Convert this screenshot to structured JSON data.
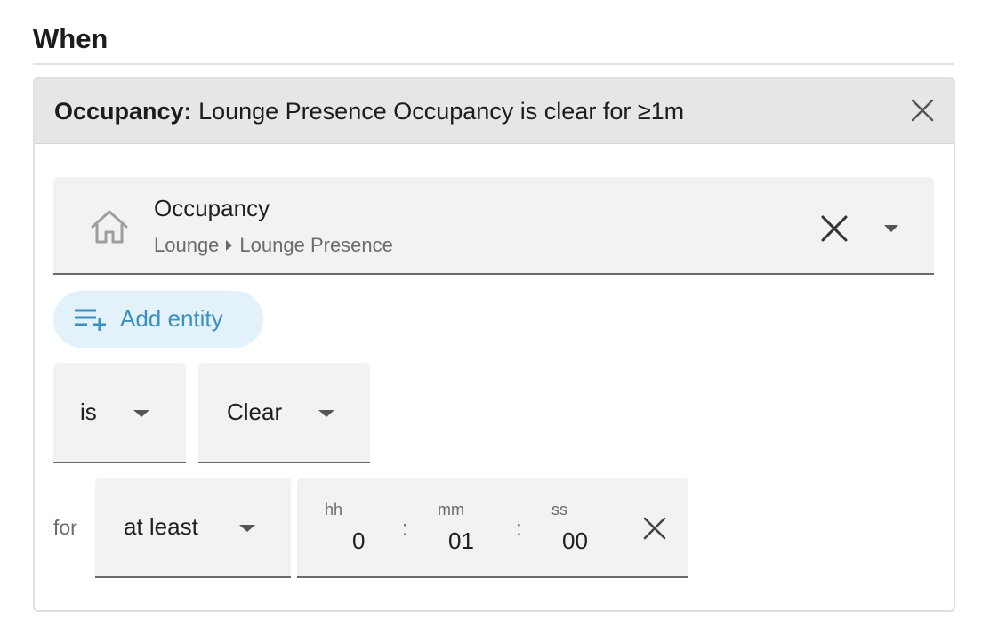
{
  "section": {
    "title": "When"
  },
  "trigger": {
    "summary_label": "Occupancy:",
    "summary_text": " Lounge Presence Occupancy is clear for ≥1m",
    "close_icon": "close-icon"
  },
  "entity": {
    "icon": "home-outline-icon",
    "name": "Occupancy",
    "area": "Lounge",
    "device": "Lounge Presence"
  },
  "add_entity": {
    "label": "Add entity",
    "icon": "playlist-plus-icon",
    "color": "#3a8fc4"
  },
  "condition": {
    "operator": "is",
    "state": "Clear"
  },
  "for": {
    "label": "for",
    "mode": "at least",
    "hh_label": "hh",
    "hh": "0",
    "mm_label": "mm",
    "mm": "01",
    "ss_label": "ss",
    "ss": "00"
  }
}
